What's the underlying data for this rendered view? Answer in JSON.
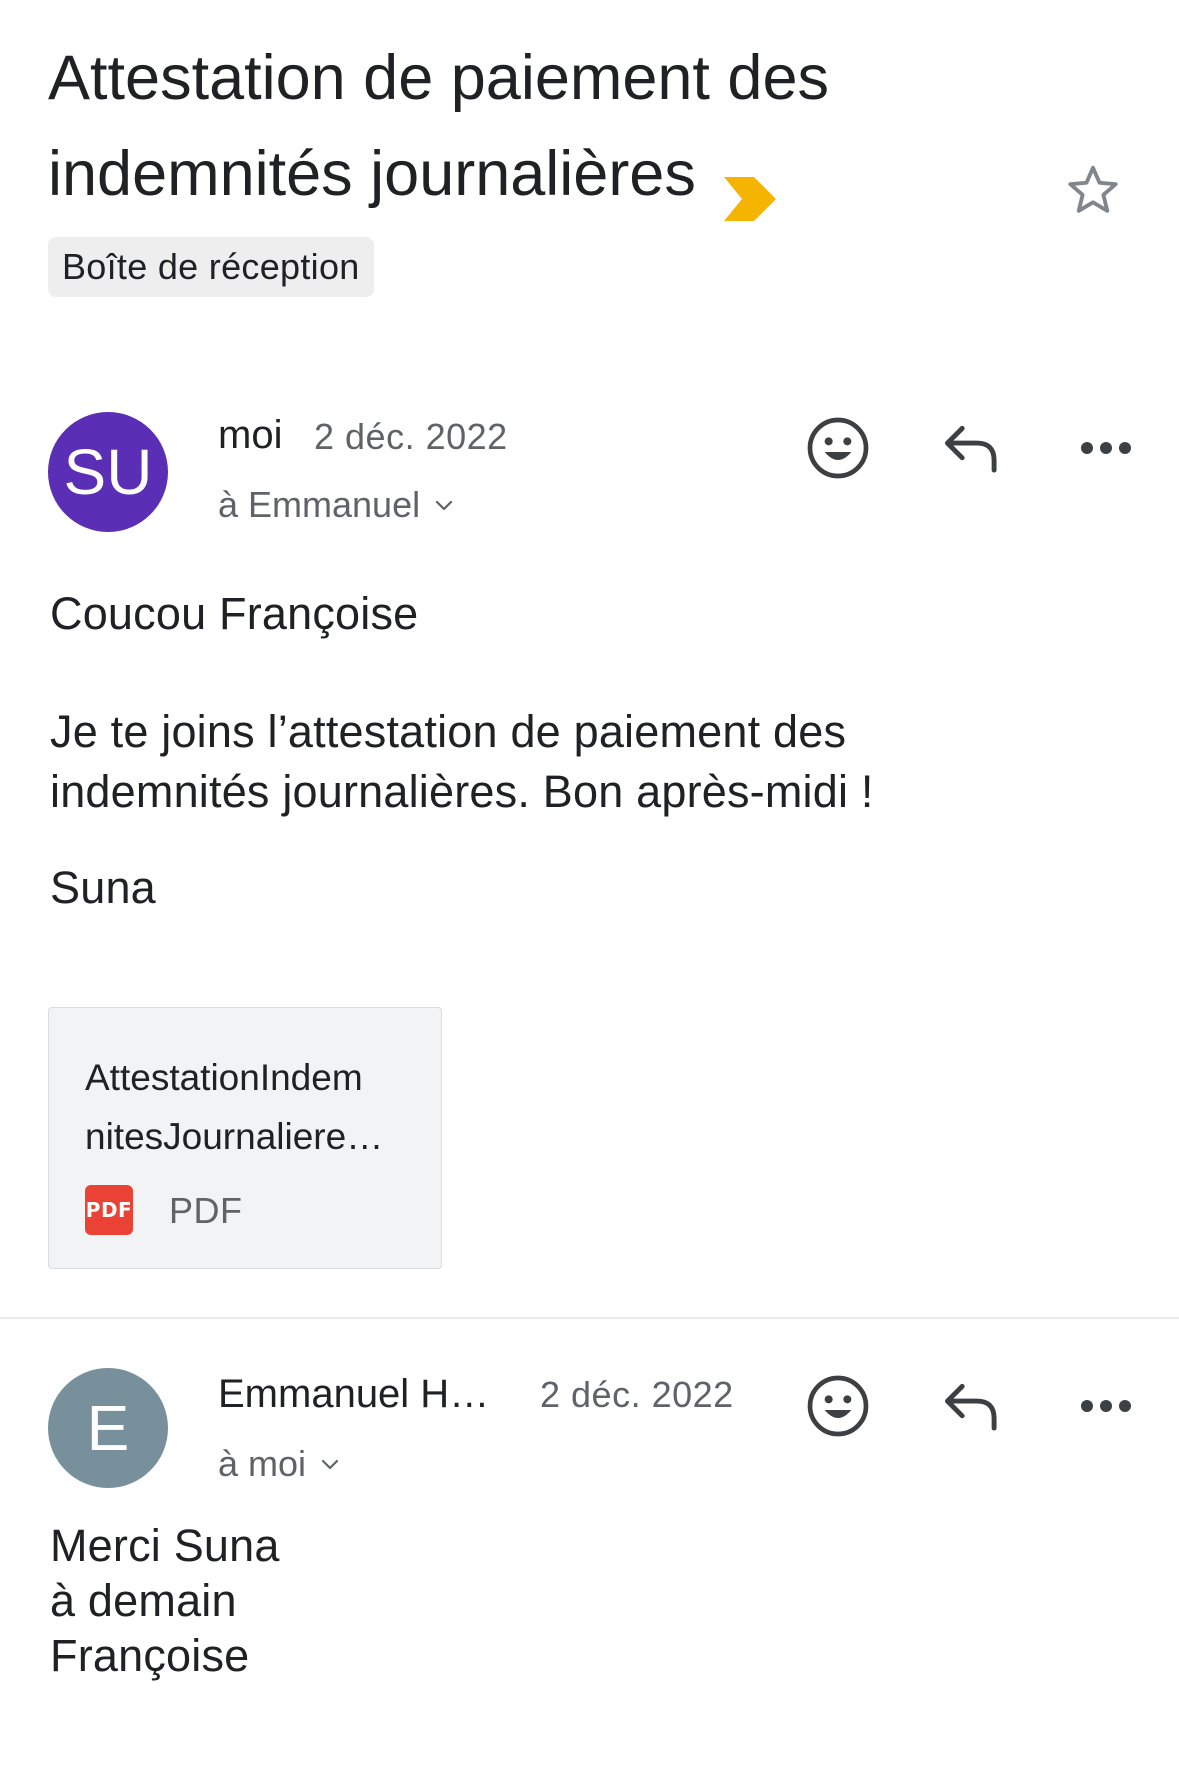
{
  "thread": {
    "subject": "Attestation de paiement des indemnités journalières",
    "label": "Boîte de réception",
    "importance_color": "#f4b400",
    "star_icon": "star-outline-icon"
  },
  "messages": [
    {
      "avatar_text": "SU",
      "avatar_color": "#5b2fb5",
      "sender": "moi",
      "date": "2 déc. 2022",
      "recipient": "à Emmanuel",
      "greeting": "Coucou Françoise",
      "paragraph": "Je te joins l’attestation de paiement des indemnités journalières. Bon après-midi !",
      "signature": "Suna",
      "attachment": {
        "name": "AttestationIndemnitesJournaliere…",
        "name_line1": "AttestationIndem",
        "name_line2": "nitesJournaliere…",
        "icon_text": "PDF",
        "type": "PDF"
      }
    },
    {
      "avatar_text": "E",
      "avatar_color": "#78909c",
      "sender": "Emmanuel H…",
      "date": "2 déc. 2022",
      "recipient": "à moi",
      "lines": [
        "Merci Suna",
        "à demain",
        "Françoise"
      ]
    }
  ],
  "icons": {
    "emoji": "emoji-reaction-icon",
    "reply": "reply-icon",
    "more": "more-options-icon",
    "chevron": "chevron-down-icon"
  }
}
